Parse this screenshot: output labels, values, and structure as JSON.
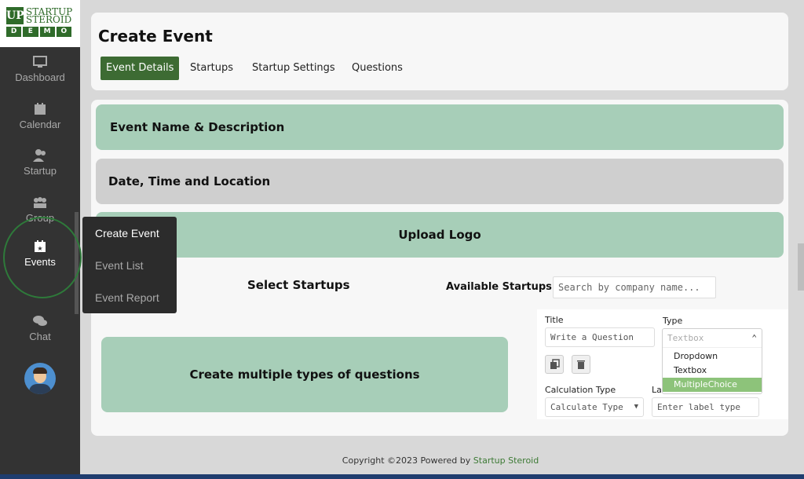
{
  "logo": {
    "up": "UP",
    "line1": "STARTUP",
    "line2": "STEROID",
    "demo": [
      "D",
      "E",
      "M",
      "O"
    ]
  },
  "nav": [
    {
      "label": "Dashboard",
      "icon": "dashboard-icon"
    },
    {
      "label": "Calendar",
      "icon": "calendar-icon"
    },
    {
      "label": "Startup",
      "icon": "users-icon"
    },
    {
      "label": "Group",
      "icon": "group-icon"
    },
    {
      "label": "Events",
      "icon": "calendar-star-icon"
    },
    {
      "label": "Chat",
      "icon": "chat-icon"
    }
  ],
  "submenu": [
    "Create Event",
    "Event List",
    "Event Report"
  ],
  "header": {
    "title": "Create Event",
    "tabs": [
      "Event Details",
      "Startups",
      "Startup Settings",
      "Questions"
    ]
  },
  "sections": {
    "name_desc": "Event Name & Description",
    "date_loc": "Date, Time and Location",
    "upload_logo": "Upload Logo"
  },
  "startups": {
    "select_label": "Select Startups",
    "available_label": "Available Startups",
    "search_placeholder": "Search by company name..."
  },
  "questions": {
    "panel_text": "Create multiple types of questions",
    "title_label": "Title",
    "title_placeholder": "Write a Question",
    "type_label": "Type",
    "type_placeholder": "Textbox",
    "type_options": [
      "Dropdown",
      "Textbox",
      "MultipleChoice"
    ],
    "selected_option": "MultipleChoice",
    "calc_label": "Calculation Type",
    "calc_value": "Calculate Type",
    "label_label": "Lat",
    "label_placeholder": "Enter label type"
  },
  "footer": {
    "prefix": "Copyright ©2023 Powered by ",
    "brand": "Startup Steroid"
  },
  "colors": {
    "accent": "#3d6b33",
    "section_green": "#a7ceb8",
    "sidebar": "#333333"
  }
}
